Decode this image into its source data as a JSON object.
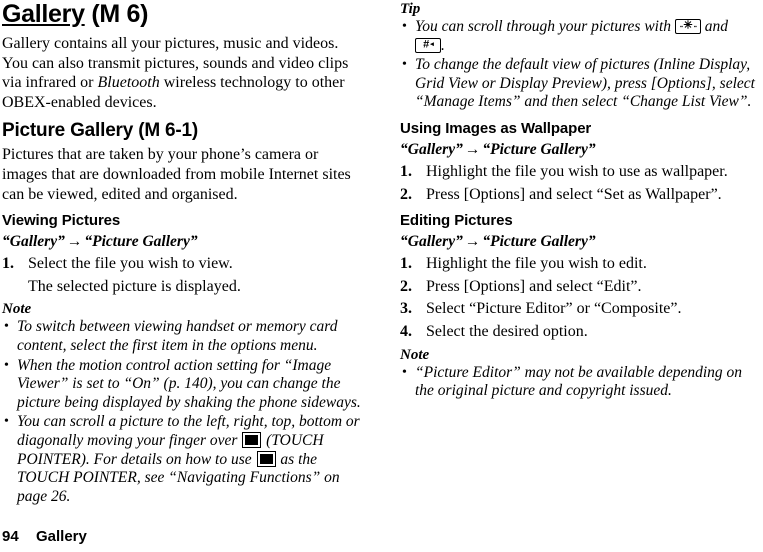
{
  "page": {
    "footer_page_number": "94",
    "footer_section": "Gallery"
  },
  "left_column": {
    "title": "Gallery",
    "title_code": " (M 6)",
    "intro": "Gallery contains all your pictures, music and videos. You can also transmit pictures, sounds and video clips via infrared or ",
    "intro_italic": "Bluetooth",
    "intro_rest": " wireless technology to other OBEX-enabled devices.",
    "section2_title": "Picture Gallery",
    "section2_code": " (M 6-1)",
    "section2_intro": "Pictures that are taken by your phone’s camera or images that are downloaded from mobile Internet sites can be viewed, edited and organised.",
    "viewing_heading": "Viewing Pictures",
    "navpath_left": "“Gallery”",
    "navpath_arrow": "→",
    "navpath_right": "“Picture Gallery”",
    "step1_num": "1.",
    "step1_text": "Select the file you wish to view.",
    "step1_result": "The selected picture is displayed.",
    "note_label": "Note",
    "note_items": [
      "To switch between viewing handset or memory card content, select the first item in the options menu.",
      "When the motion control action setting for “Image Viewer” is set to “On” (p. 140), you can change the picture being displayed by shaking the phone sideways."
    ],
    "note_bullet3_a": "You can scroll a picture to the left, right, top, bottom or diagonally moving your finger over ",
    "note_bullet3_b": " (TOUCH POINTER). For details on how to use ",
    "note_bullet3_c": " as the TOUCH POINTER, see “Navigating Functions” on page 26."
  },
  "right_column": {
    "tip_label": "Tip",
    "tip1_a": "You can scroll through your pictures with ",
    "tip1_key1_glyph": "✳",
    "tip1_mid": " and ",
    "tip1_key2_glyph": "#",
    "tip1_end": ".",
    "tip2": "To change the default view of pictures (Inline Display, Grid View or Display Preview), press [Options], select “Manage Items” and then select “Change List View”.",
    "wallpaper_heading": "Using Images as Wallpaper",
    "wallpaper_navpath_left": "“Gallery”",
    "wallpaper_navpath_arrow": "→",
    "wallpaper_navpath_right": "“Picture Gallery”",
    "wallpaper_step1_num": "1.",
    "wallpaper_step1_text": "Highlight the file you wish to use as wallpaper.",
    "wallpaper_step2_num": "2.",
    "wallpaper_step2_text": "Press [Options] and select “Set as Wallpaper”.",
    "editing_heading": "Editing Pictures",
    "editing_navpath_left": "“Gallery”",
    "editing_navpath_arrow": "→",
    "editing_navpath_right": "“Picture Gallery”",
    "editing_step1_num": "1.",
    "editing_step1_text": "Highlight the file you wish to edit.",
    "editing_step2_num": "2.",
    "editing_step2_text": "Press [Options] and select “Edit”.",
    "editing_step3_num": "3.",
    "editing_step3_text": "Select “Picture Editor” or “Composite”.",
    "editing_step4_num": "4.",
    "editing_step4_text": "Select the desired option.",
    "note_label": "Note",
    "note_item1": "“Picture Editor” may not be available depending on the original picture and copyright issued."
  },
  "colors": {
    "text": "#000000",
    "background": "#ffffff"
  }
}
